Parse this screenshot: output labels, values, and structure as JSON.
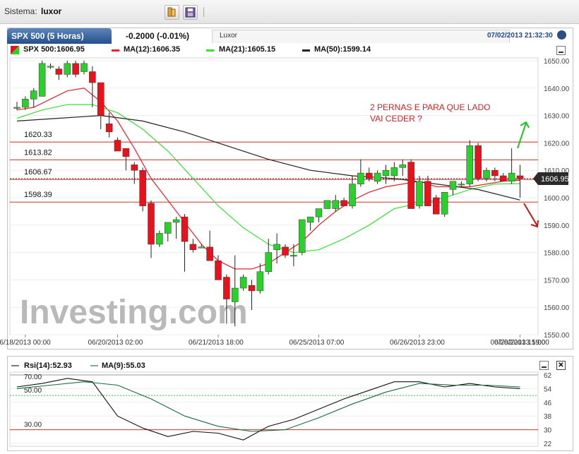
{
  "topbar": {
    "label": "Sistema:",
    "system": "luxor"
  },
  "header": {
    "tab_title": "SPX 500 (5 Horas)",
    "change": "-0.2000 (-0.01%)",
    "tab_name": "Luxor",
    "datetime": "07/02/2013 21:32:30"
  },
  "legend": {
    "price": "SPX 500:1606.95",
    "ma12": "MA(12):1606.35",
    "ma21": "MA(21):1605.15",
    "ma50": "MA(50):1599.14"
  },
  "annotation": {
    "line1": "2 PERNAS E PARA QUE LADO",
    "line2": "VAI CEDER ?"
  },
  "watermark": "Investing.com",
  "rsi_legend": {
    "rsi": "Rsi(14):52.93",
    "ma": "MA(9):55.03"
  },
  "colors": {
    "ma12": "#e8212a",
    "ma21": "#35e335",
    "ma50": "#222222",
    "bull": "#2bd12b",
    "bear": "#e8121d",
    "level": "#d0312d",
    "annotation": "#c8262a"
  },
  "chart_data": [
    {
      "type": "candlestick",
      "title": "SPX 500 (5 Horas)",
      "ylim": [
        1550,
        1650
      ],
      "yticks": [
        1550,
        1560,
        1570,
        1580,
        1590,
        1600,
        1610,
        1620,
        1630,
        1640,
        1650
      ],
      "ytick_labels": [
        "1550.00",
        "1560.00",
        "1570.00",
        "1580.00",
        "1590.00",
        "1600.00",
        "1610.00",
        "1620.00",
        "1630.00",
        "1640.00",
        "1650.00"
      ],
      "xtick_labels": [
        "06/18/2013 00:00",
        "06/20/2013 02:00",
        "06/21/2013 18:00",
        "06/25/2013 07:00",
        "06/26/2013 23:00",
        "06/28/2013 15:00",
        "07/02/2013 19:00"
      ],
      "xtick_index": [
        1,
        12,
        24,
        36,
        48,
        60,
        72
      ],
      "last_price": {
        "value": 1606.95,
        "label": "1606.95"
      },
      "levels": [
        {
          "value": 1620.33,
          "label": "1620.33"
        },
        {
          "value": 1613.82,
          "label": "1613.82"
        },
        {
          "value": 1606.67,
          "label": "1606.67"
        },
        {
          "value": 1598.39,
          "label": "1598.39"
        }
      ],
      "candles": [
        [
          1633,
          1635,
          1632,
          1633
        ],
        [
          1633,
          1637,
          1632,
          1636
        ],
        [
          1636,
          1640,
          1633,
          1639
        ],
        [
          1637,
          1650,
          1637,
          1649
        ],
        [
          1648,
          1649,
          1647,
          1648
        ],
        [
          1647,
          1648,
          1643,
          1645
        ],
        [
          1645,
          1650,
          1644,
          1649
        ],
        [
          1649,
          1650,
          1644,
          1645
        ],
        [
          1646,
          1650,
          1645,
          1649
        ],
        [
          1646,
          1648,
          1633,
          1642
        ],
        [
          1642,
          1642,
          1625,
          1630
        ],
        [
          1627,
          1631,
          1622,
          1624
        ],
        [
          1621,
          1622,
          1617,
          1617
        ],
        [
          1618,
          1618,
          1610,
          1615
        ],
        [
          1612,
          1613,
          1605,
          1610
        ],
        [
          1610,
          1611,
          1595,
          1597
        ],
        [
          1598,
          1599,
          1578,
          1583
        ],
        [
          1583,
          1588,
          1582,
          1587
        ],
        [
          1587,
          1588,
          1584,
          1591
        ],
        [
          1591,
          1593,
          1585,
          1592
        ],
        [
          1593,
          1594,
          1573,
          1584
        ],
        [
          1583,
          1585,
          1580,
          1581
        ],
        [
          1582,
          1583,
          1582,
          1582
        ],
        [
          1582,
          1588,
          1577,
          1577
        ],
        [
          1577,
          1579,
          1570,
          1570
        ],
        [
          1571,
          1572,
          1554,
          1563
        ],
        [
          1562,
          1579,
          1553,
          1567
        ],
        [
          1567,
          1572,
          1566,
          1571
        ],
        [
          1568,
          1570,
          1559,
          1566
        ],
        [
          1566,
          1576,
          1565,
          1573
        ],
        [
          1573,
          1585,
          1572,
          1580
        ],
        [
          1581,
          1587,
          1576,
          1583
        ],
        [
          1582,
          1583,
          1578,
          1579
        ],
        [
          1579,
          1583,
          1575,
          1579
        ],
        [
          1580,
          1592,
          1579,
          1592
        ],
        [
          1591,
          1592,
          1588,
          1593
        ],
        [
          1593,
          1595,
          1591,
          1596
        ],
        [
          1596,
          1599,
          1596,
          1599
        ],
        [
          1596,
          1601,
          1595,
          1599
        ],
        [
          1599,
          1600,
          1597,
          1597
        ],
        [
          1597,
          1608,
          1596,
          1605
        ],
        [
          1605,
          1614,
          1604,
          1609
        ],
        [
          1609,
          1611,
          1606,
          1607
        ],
        [
          1606,
          1610,
          1605,
          1609
        ],
        [
          1608,
          1612,
          1605,
          1610
        ],
        [
          1608,
          1613,
          1606,
          1611
        ],
        [
          1611,
          1614,
          1608,
          1612
        ],
        [
          1613,
          1614,
          1596,
          1596
        ],
        [
          1597,
          1608,
          1596,
          1606
        ],
        [
          1606,
          1608,
          1597,
          1597
        ],
        [
          1600,
          1601,
          1594,
          1594
        ],
        [
          1594,
          1597,
          1593,
          1602
        ],
        [
          1603,
          1606,
          1601,
          1606
        ],
        [
          1605,
          1606,
          1604,
          1605
        ],
        [
          1605,
          1621,
          1604,
          1619
        ],
        [
          1619,
          1620,
          1606,
          1607
        ],
        [
          1607,
          1611,
          1606,
          1610
        ],
        [
          1610,
          1611,
          1606,
          1608
        ],
        [
          1608,
          1609,
          1606,
          1606
        ],
        [
          1606,
          1618,
          1605,
          1609
        ],
        [
          1608,
          1612,
          1600,
          1607
        ]
      ],
      "series": [
        {
          "name": "MA(12)",
          "x": [
            0,
            2,
            4,
            6,
            8,
            10,
            12,
            14,
            16,
            18,
            20,
            22,
            24,
            26,
            28,
            30,
            32,
            34,
            36,
            38,
            40,
            42,
            44,
            46,
            48,
            50,
            52,
            54,
            56,
            58,
            60
          ],
          "values": [
            1632,
            1633,
            1636,
            1639,
            1640,
            1635,
            1628,
            1618,
            1607,
            1599,
            1591,
            1583,
            1577,
            1574,
            1574,
            1576,
            1580,
            1584,
            1590,
            1595,
            1599,
            1602,
            1604,
            1605,
            1606,
            1604,
            1604,
            1604,
            1605,
            1606,
            1606.35
          ]
        },
        {
          "name": "MA(21)",
          "x": [
            0,
            3,
            6,
            9,
            12,
            15,
            18,
            21,
            24,
            27,
            30,
            33,
            36,
            39,
            42,
            45,
            48,
            51,
            54,
            57,
            60
          ],
          "values": [
            1629,
            1632,
            1634,
            1634,
            1631,
            1625,
            1617,
            1607,
            1597,
            1589,
            1583,
            1580,
            1581,
            1585,
            1590,
            1596,
            1598,
            1600,
            1603,
            1605,
            1605.15
          ]
        },
        {
          "name": "MA(50)",
          "x": [
            0,
            5,
            10,
            15,
            20,
            25,
            30,
            35,
            40,
            45,
            50,
            55,
            60
          ],
          "values": [
            1628,
            1629,
            1630,
            1628,
            1624,
            1619,
            1614,
            1610,
            1608,
            1607,
            1605,
            1603,
            1599.14
          ]
        }
      ]
    },
    {
      "type": "line",
      "title": "Rsi(14)",
      "ylim": [
        22,
        62
      ],
      "right_ticks": [
        22,
        30,
        38,
        46,
        54,
        62
      ],
      "levels": [
        {
          "value": 70,
          "label": "70.00"
        },
        {
          "value": 50,
          "label": "50.00"
        },
        {
          "value": 30,
          "label": "30.00"
        }
      ],
      "series": [
        {
          "name": "Rsi(14)",
          "x": [
            0,
            3,
            6,
            9,
            12,
            15,
            18,
            21,
            24,
            27,
            30,
            33,
            36,
            39,
            42,
            45,
            48,
            51,
            54,
            57,
            60
          ],
          "values": [
            55,
            57,
            60,
            58,
            38,
            31,
            26,
            29,
            28,
            24,
            32,
            36,
            42,
            48,
            53,
            58,
            58,
            55,
            57,
            55,
            54
          ]
        },
        {
          "name": "MA(9)",
          "x": [
            0,
            4,
            8,
            12,
            16,
            20,
            24,
            28,
            32,
            36,
            40,
            44,
            48,
            52,
            56,
            60
          ],
          "values": [
            54,
            56,
            58,
            56,
            48,
            38,
            32,
            29,
            30,
            37,
            45,
            52,
            57,
            56,
            56,
            55
          ]
        }
      ]
    }
  ]
}
